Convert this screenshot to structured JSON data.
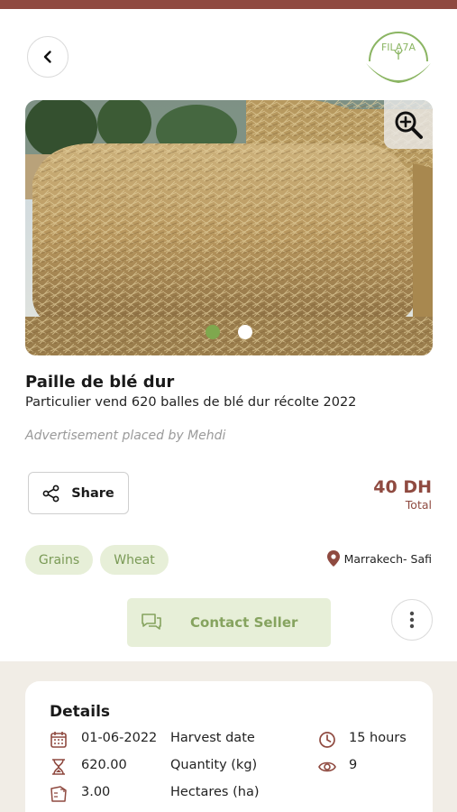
{
  "header": {
    "logo_text": "FILA7A"
  },
  "listing": {
    "title": "Paille de blé dur",
    "subtitle": "Particulier vend 620 balles de blé dur récolte 2022",
    "placed_by": "Advertisement placed by Mehdi",
    "image_count": 2,
    "active_image": 1
  },
  "actions": {
    "share_label": "Share",
    "contact_label": "Contact Seller"
  },
  "price": {
    "amount": "40 DH",
    "note": "Total"
  },
  "tags": [
    "Grains",
    "Wheat"
  ],
  "location": "Marrakech- Safi",
  "details": {
    "title": "Details",
    "rows": [
      {
        "icon": "calendar-icon",
        "value": "01-06-2022",
        "label": "Harvest date",
        "side_icon": "clock-icon",
        "side_value": "15 hours"
      },
      {
        "icon": "hourglass-icon",
        "value": "620.00",
        "label": "Quantity (kg)",
        "side_icon": "eye-icon",
        "side_value": "9"
      },
      {
        "icon": "field-area-icon",
        "value": "3.00",
        "label": "Hectares (ha)"
      }
    ]
  },
  "colors": {
    "brand_brown": "#8f4a40",
    "brand_green": "#7fa84e",
    "tag_bg": "#e7efd8",
    "section_bg": "#f1ede6"
  }
}
